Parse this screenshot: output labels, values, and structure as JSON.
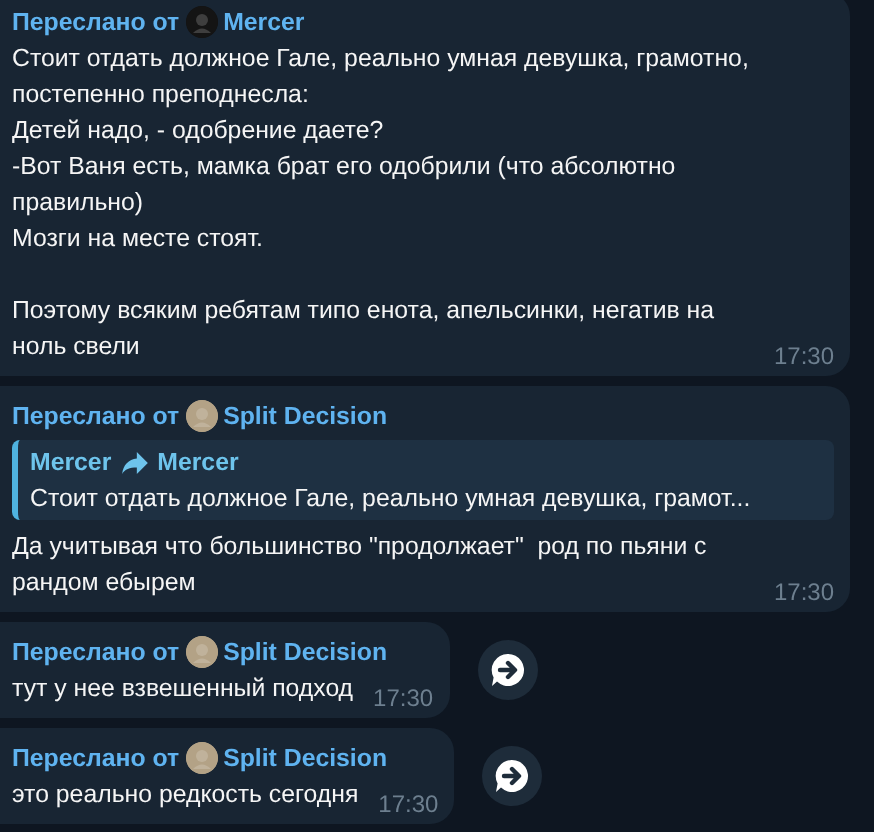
{
  "messages": [
    {
      "forwarded_label": "Переслано от",
      "sender": "Mercer",
      "color": "#141414",
      "text": "Стоит отдать должное Гале, реально умная девушка, грамотно, постепенно преподнесла:\nДетей надо, - одобрение даете?\n-Вот Ваня есть, мамка брат его одобрили (что абсолютно правильно)\nМозги на месте стоят.\n\nПоэтому всяким ребятам типо енота, апельсинки, негатив на ноль свели",
      "time": "17:30",
      "share_button": false
    },
    {
      "forwarded_label": "Переслано от",
      "sender": "Split Decision",
      "color": "#b3a286",
      "reply": {
        "from": "Mercer",
        "to": "Mercer",
        "text": "Стоит отдать должное Гале, реально умная девушка, грамот..."
      },
      "text": "Да учитывая что большинство \"продолжает\"  род по пьяни с рандом ебырем",
      "time": "17:30",
      "share_button": false
    },
    {
      "forwarded_label": "Переслано от",
      "sender": "Split Decision",
      "color": "#b3a286",
      "text": "тут у нее взвешенный подход",
      "time": "17:30",
      "share_button": true
    },
    {
      "forwarded_label": "Переслано от",
      "sender": "Split Decision",
      "color": "#b3a286",
      "text": "это реально редкость сегодня",
      "time": "17:30",
      "share_button": true
    }
  ]
}
